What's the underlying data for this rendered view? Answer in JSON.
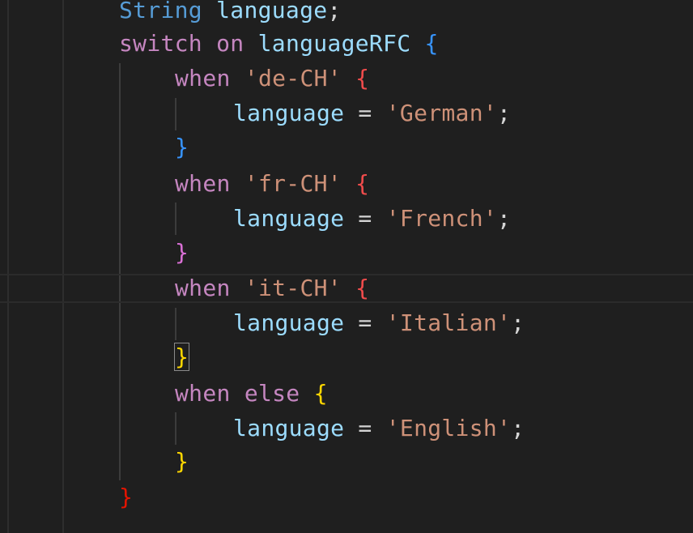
{
  "colors": {
    "background": "#1f1f1f",
    "keyword": "#c586c0",
    "type": "#569cd6",
    "variable": "#9cdcfe",
    "string": "#ce9178",
    "operator": "#d4d4d4",
    "bracket_blue": "#3794ff",
    "bracket_red": "#f14c4c",
    "bracket_pink": "#da70d6",
    "bracket_gold": "#ffd700",
    "bracket_outer": "#e51400"
  },
  "code": {
    "lines": [
      {
        "tokens": [
          {
            "text": "String",
            "color": "#569cd6"
          },
          {
            "text": " ",
            "color": "#d4d4d4"
          },
          {
            "text": "language",
            "color": "#9cdcfe"
          },
          {
            "text": ";",
            "color": "#d4d4d4"
          }
        ]
      },
      {
        "tokens": [
          {
            "text": "switch",
            "color": "#c586c0"
          },
          {
            "text": " ",
            "color": "#d4d4d4"
          },
          {
            "text": "on",
            "color": "#c586c0"
          },
          {
            "text": " ",
            "color": "#d4d4d4"
          },
          {
            "text": "languageRFC",
            "color": "#9cdcfe"
          },
          {
            "text": " ",
            "color": "#d4d4d4"
          },
          {
            "text": "{",
            "color": "#3794ff"
          }
        ]
      },
      {
        "tokens": [
          {
            "text": "when",
            "color": "#c586c0"
          },
          {
            "text": " ",
            "color": "#d4d4d4"
          },
          {
            "text": "'de-CH'",
            "color": "#ce9178"
          },
          {
            "text": " ",
            "color": "#d4d4d4"
          },
          {
            "text": "{",
            "color": "#f14c4c"
          }
        ]
      },
      {
        "tokens": [
          {
            "text": "language",
            "color": "#9cdcfe"
          },
          {
            "text": " = ",
            "color": "#d4d4d4"
          },
          {
            "text": "'German'",
            "color": "#ce9178"
          },
          {
            "text": ";",
            "color": "#d4d4d4"
          }
        ]
      },
      {
        "tokens": [
          {
            "text": "}",
            "color": "#3794ff"
          }
        ]
      },
      {
        "tokens": [
          {
            "text": "when",
            "color": "#c586c0"
          },
          {
            "text": " ",
            "color": "#d4d4d4"
          },
          {
            "text": "'fr-CH'",
            "color": "#ce9178"
          },
          {
            "text": " ",
            "color": "#d4d4d4"
          },
          {
            "text": "{",
            "color": "#f14c4c"
          }
        ]
      },
      {
        "tokens": [
          {
            "text": "language",
            "color": "#9cdcfe"
          },
          {
            "text": " = ",
            "color": "#d4d4d4"
          },
          {
            "text": "'French'",
            "color": "#ce9178"
          },
          {
            "text": ";",
            "color": "#d4d4d4"
          }
        ]
      },
      {
        "tokens": [
          {
            "text": "}",
            "color": "#da70d6"
          }
        ]
      },
      {
        "tokens": [
          {
            "text": "when",
            "color": "#c586c0"
          },
          {
            "text": " ",
            "color": "#d4d4d4"
          },
          {
            "text": "'it-CH'",
            "color": "#ce9178"
          },
          {
            "text": " ",
            "color": "#d4d4d4"
          },
          {
            "text": "{",
            "color": "#f14c4c"
          }
        ]
      },
      {
        "tokens": [
          {
            "text": "language",
            "color": "#9cdcfe"
          },
          {
            "text": " = ",
            "color": "#d4d4d4"
          },
          {
            "text": "'Italian'",
            "color": "#ce9178"
          },
          {
            "text": ";",
            "color": "#d4d4d4"
          }
        ]
      },
      {
        "tokens": [
          {
            "text": "}",
            "color": "#ffd700",
            "matched": true
          }
        ]
      },
      {
        "tokens": [
          {
            "text": "when",
            "color": "#c586c0"
          },
          {
            "text": " ",
            "color": "#d4d4d4"
          },
          {
            "text": "else",
            "color": "#c586c0"
          },
          {
            "text": " ",
            "color": "#d4d4d4"
          },
          {
            "text": "{",
            "color": "#ffd700"
          }
        ]
      },
      {
        "tokens": [
          {
            "text": "language",
            "color": "#9cdcfe"
          },
          {
            "text": " = ",
            "color": "#d4d4d4"
          },
          {
            "text": "'English'",
            "color": "#ce9178"
          },
          {
            "text": ";",
            "color": "#d4d4d4"
          }
        ]
      },
      {
        "tokens": [
          {
            "text": "}",
            "color": "#ffd700"
          }
        ]
      },
      {
        "tokens": [
          {
            "text": "}",
            "color": "#e51400"
          }
        ]
      }
    ]
  }
}
